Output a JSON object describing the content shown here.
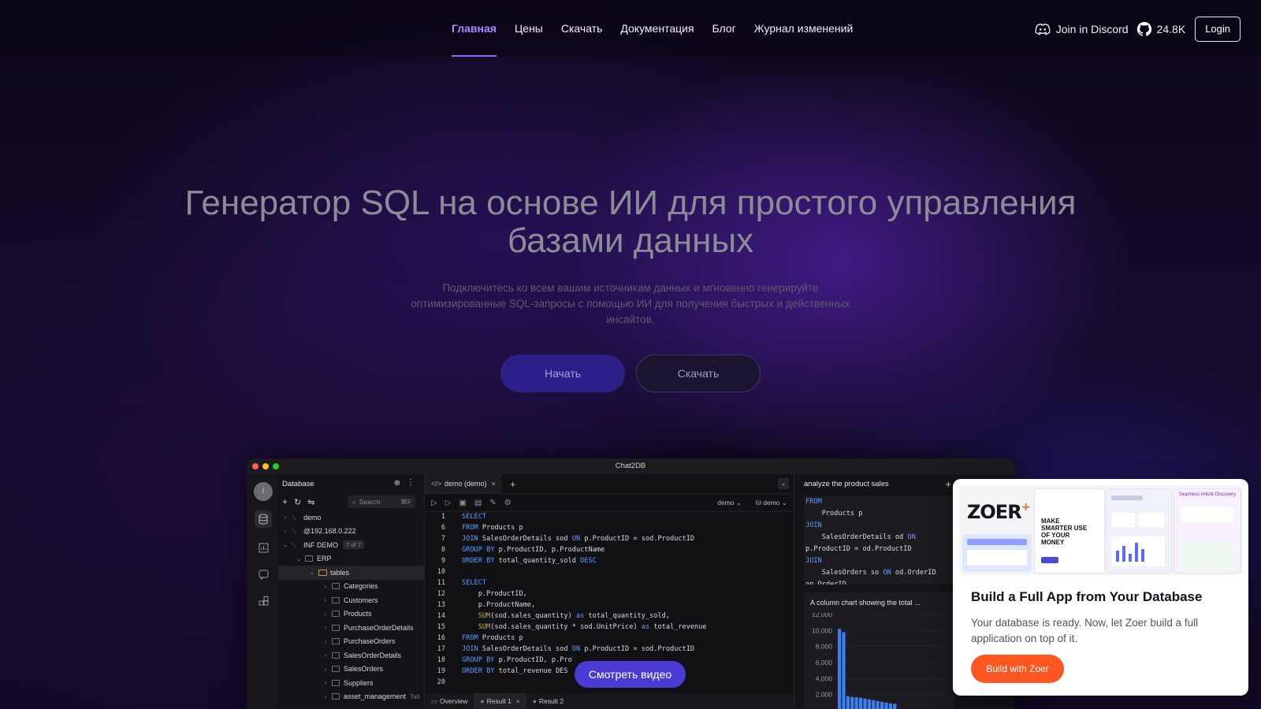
{
  "nav": {
    "links": [
      "Главная",
      "Цены",
      "Скачать",
      "Документация",
      "Блог",
      "Журнал изменений"
    ],
    "discord_label": "Join in Discord",
    "github_stars": "24.8K",
    "login_label": "Login"
  },
  "hero": {
    "title_line1": "Генератор SQL на основе ИИ для простого управления",
    "title_line2": "базами данных",
    "subtitle": "Подключитесь ко всем вашим источникам данных и мгновенно генерируйте оптимизированные SQL-запросы с помощью ИИ для получения быстрых и действенных инсайтов.",
    "start_label": "Начать",
    "download_label": "Скачать"
  },
  "app": {
    "window_title": "Chat2DB",
    "avatar_letter": "i",
    "sidebar": {
      "title": "Database",
      "search_placeholder": "Search",
      "search_shortcut": "⌘F",
      "items": [
        {
          "label": "demo",
          "depth": 0,
          "type": "conn"
        },
        {
          "label": "@192.168.0.222",
          "depth": 0,
          "type": "conn"
        },
        {
          "label": "INF DEMO",
          "depth": 0,
          "type": "conn",
          "badge": "7 of 7"
        },
        {
          "label": "ERP",
          "depth": 1,
          "type": "db"
        },
        {
          "label": "tables",
          "depth": 2,
          "type": "folder"
        },
        {
          "label": "Categories",
          "depth": 3,
          "type": "table"
        },
        {
          "label": "Customers",
          "depth": 3,
          "type": "table"
        },
        {
          "label": "Products",
          "depth": 3,
          "type": "table"
        },
        {
          "label": "PurchaseOrderDetails",
          "depth": 3,
          "type": "table"
        },
        {
          "label": "PurchaseOrders",
          "depth": 3,
          "type": "table"
        },
        {
          "label": "SalesOrderDetails",
          "depth": 3,
          "type": "table"
        },
        {
          "label": "SalesOrders",
          "depth": 3,
          "type": "table"
        },
        {
          "label": "Suppliers",
          "depth": 3,
          "type": "table"
        },
        {
          "label": "asset_management",
          "depth": 3,
          "type": "table",
          "suffix": "Tab"
        }
      ]
    },
    "editor": {
      "tab_label": "demo (demo)",
      "db_select_1": "demo",
      "db_select_2": "demo",
      "lines": [
        {
          "n": "1",
          "code": "SELECT"
        },
        {
          "n": "6",
          "code": "FROM Products p"
        },
        {
          "n": "7",
          "code": "JOIN SalesOrderDetails sod ON p.ProductID = sod.ProductID"
        },
        {
          "n": "8",
          "code": "GROUP BY p.ProductID, p.ProductName"
        },
        {
          "n": "9",
          "code": "ORDER BY total_quantity_sold DESC"
        },
        {
          "n": "10",
          "code": ""
        },
        {
          "n": "11",
          "code": "SELECT"
        },
        {
          "n": "12",
          "code": "    p.ProductID,"
        },
        {
          "n": "13",
          "code": "    p.ProductName,"
        },
        {
          "n": "14",
          "code": "    SUM(sod.sales_quantity) as total_quantity_sold,"
        },
        {
          "n": "15",
          "code": "    SUM(sod.sales_quantity * sod.UnitPrice) as total_revenue"
        },
        {
          "n": "16",
          "code": "FROM Products p"
        },
        {
          "n": "17",
          "code": "JOIN SalesOrderDetails sod ON p.ProductID = sod.ProductID"
        },
        {
          "n": "18",
          "code": "GROUP BY p.ProductID, p.Pro"
        },
        {
          "n": "19",
          "code": "ORDER BY total_revenue DES"
        },
        {
          "n": "20",
          "code": ""
        }
      ],
      "bottom_tabs": [
        "Overview",
        "Result 1",
        "Result 2"
      ]
    },
    "chat": {
      "title": "analyze the product sales",
      "code_lines": [
        "FROM",
        "    Products p",
        "JOIN",
        "    SalesOrderDetails od ON",
        "p.ProductID = od.ProductID",
        "JOIN",
        "    SalesOrders so ON od.OrderID",
        "on.OrderID"
      ],
      "chart_title": "A column chart showing the total ...",
      "chart_data": {
        "type": "bar",
        "ylim": [
          0,
          12000
        ],
        "yticks": [
          "12,000",
          "10,000",
          "8,000",
          "6,000",
          "4,000",
          "2,000"
        ],
        "values": [
          10200,
          9800,
          1800,
          1700,
          1650,
          1600,
          1500,
          1400,
          1300,
          1200,
          1100,
          1000,
          900,
          850
        ]
      }
    }
  },
  "video_label": "Смотреть видео",
  "popup": {
    "logo": "ZOER",
    "preview_heading": "MAKE SMARTER USE OF YOUR MONEY",
    "preview_tag": "Seamless Article Discovery",
    "title": "Build a Full App from Your Database",
    "text": "Your database is ready. Now, let Zoer build a full application on top of it.",
    "button_label": "Build with Zoer",
    "accent": "#ff5722"
  }
}
